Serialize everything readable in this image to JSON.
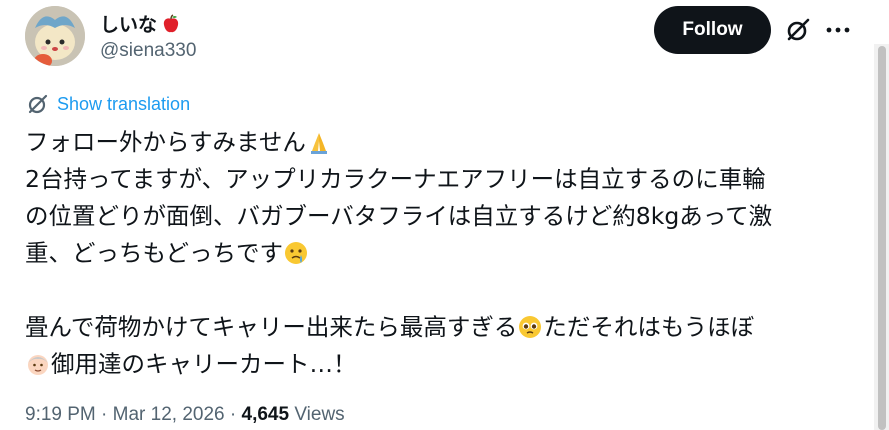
{
  "author": {
    "display_name": "しいな",
    "handle": "@siena330",
    "name_emoji": "red-apple-icon"
  },
  "actions": {
    "follow_label": "Follow",
    "grok_icon": "grok-icon",
    "more_icon": "more-options-icon"
  },
  "translation": {
    "label": "Show translation",
    "icon": "translate-icon"
  },
  "tweet": {
    "line1": "フォロー外からすみません",
    "line2": "2台持ってますが、アップリカラクーナエアフリーは自立するのに車輪",
    "line3": "の位置どりが面倒、バガブーバタフライは自立するけど約8kgあって激",
    "line4": "重、どっちもどっちです",
    "line5": "畳んで荷物かけてキャリー出来たら最高すぎる",
    "line5b": "ただそれはもうほぼ",
    "line6": "御用達のキャリーカート…！",
    "emojis": [
      "folded-hands-icon",
      "face-holding-back-tears-icon",
      "pleading-face-icon",
      "old-person-icon"
    ]
  },
  "meta": {
    "time": "9:19 PM",
    "date": "Mar 12, 2026",
    "separator": "·",
    "views_count": "4,645",
    "views_label": "Views"
  },
  "colors": {
    "accent": "#1d9bf0",
    "text": "#0f1419",
    "secondary": "#536471",
    "follow_bg": "#0f1419"
  }
}
